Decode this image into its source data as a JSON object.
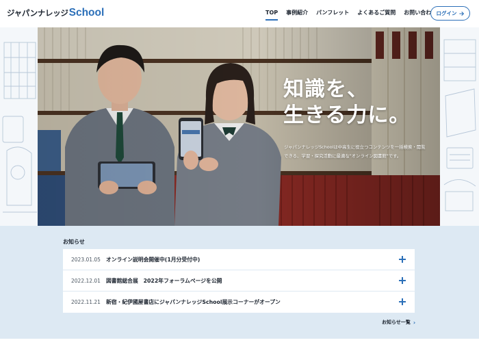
{
  "header": {
    "logo_jp": "ジャパンナレッジ",
    "logo_en": "School",
    "nav": [
      {
        "label": "TOP",
        "active": true
      },
      {
        "label": "事例紹介",
        "active": false
      },
      {
        "label": "パンフレット",
        "active": false
      },
      {
        "label": "よくあるご質問",
        "active": false
      },
      {
        "label": "お問い合わせ",
        "active": false
      }
    ],
    "login_label": "ログイン",
    "accent_color": "#2b6fb8"
  },
  "hero": {
    "title_line1": "知識を、",
    "title_line2": "生きる力に。",
    "description": "ジャパンナレッジSchoolは中高生に役立つコンテンツを一括検索・閲覧できる、学習・探究活動に最適な\"オンライン図書館\"です。"
  },
  "news": {
    "heading": "お知らせ",
    "items": [
      {
        "date": "2023.01.05",
        "title": "オンライン説明会開催中(1月分受付中)"
      },
      {
        "date": "2022.12.01",
        "title": "図書館総合展　2022年フォーラムページを公開"
      },
      {
        "date": "2022.11.21",
        "title": "新宿・紀伊國屋書店にジャパンナレッジSchool展示コーナーがオープン"
      }
    ],
    "more_label": "お知らせ一覧"
  }
}
